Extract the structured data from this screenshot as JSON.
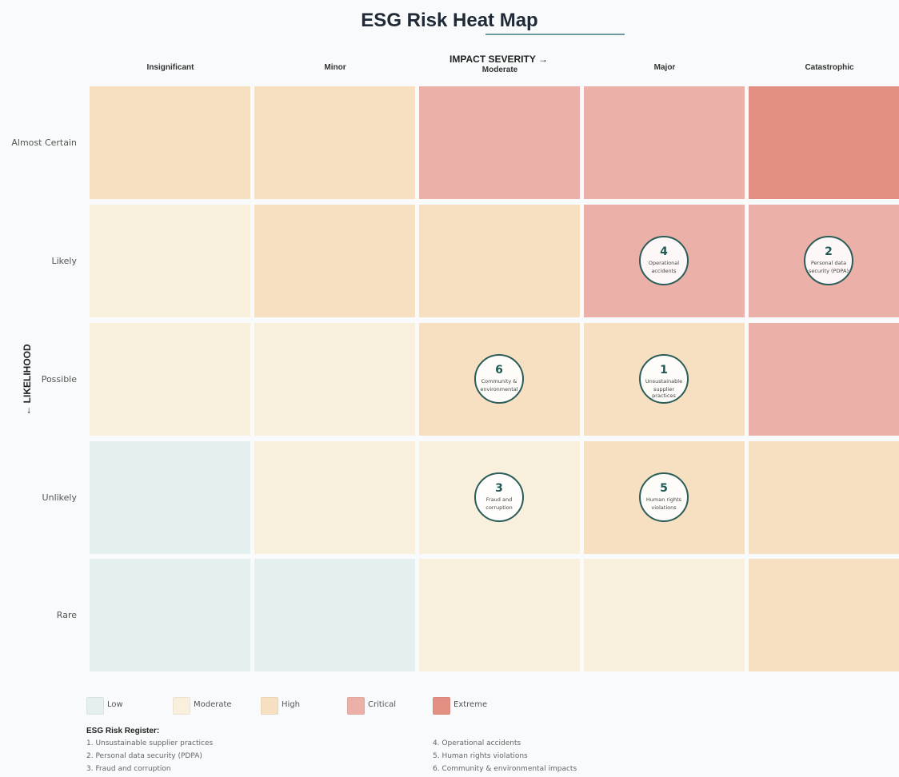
{
  "title": "ESG Risk Heat Map",
  "chart_data": {
    "type": "heatmap",
    "title": "ESG Risk Heat Map",
    "xlabel": "IMPACT SEVERITY →",
    "ylabel": "← LIKELIHOOD",
    "columns": [
      "Insignificant",
      "Minor",
      "Moderate",
      "Major",
      "Catastrophic"
    ],
    "rows": [
      "Almost Certain",
      "Likely",
      "Possible",
      "Unlikely",
      "Rare"
    ],
    "levels": [
      [
        "High",
        "High",
        "Critical",
        "Critical",
        "Extreme"
      ],
      [
        "Moderate",
        "High",
        "High",
        "Critical",
        "Critical"
      ],
      [
        "Moderate",
        "Moderate",
        "High",
        "High",
        "Critical"
      ],
      [
        "Low",
        "Moderate",
        "Moderate",
        "High",
        "High"
      ],
      [
        "Low",
        "Low",
        "Moderate",
        "Moderate",
        "High"
      ]
    ],
    "risks": [
      {
        "id": "1",
        "label": "Unsustainable supplier practices",
        "likelihood": "Possible",
        "impact": "Major"
      },
      {
        "id": "2",
        "label": "Personal data security (PDPA)",
        "likelihood": "Likely",
        "impact": "Catastrophic"
      },
      {
        "id": "3",
        "label": "Fraud and corruption",
        "likelihood": "Unlikely",
        "impact": "Moderate"
      },
      {
        "id": "4",
        "label": "Operational accidents",
        "likelihood": "Likely",
        "impact": "Major"
      },
      {
        "id": "5",
        "label": "Human rights violations",
        "likelihood": "Unlikely",
        "impact": "Major"
      },
      {
        "id": "6",
        "label": "Community & environmental impacts",
        "likelihood": "Possible",
        "impact": "Moderate"
      }
    ],
    "legend": [
      {
        "label": "Low",
        "color": "#e3f0ef"
      },
      {
        "label": "Moderate",
        "color": "#f8efdd"
      },
      {
        "label": "High",
        "color": "#f6e0c1"
      },
      {
        "label": "Critical",
        "color": "#ebb0a8"
      },
      {
        "label": "Extreme",
        "color": "#e48f84"
      }
    ]
  },
  "register": {
    "title": "ESG Risk Register:",
    "items": [
      "1. Unsustainable supplier practices",
      "2. Personal data security (PDPA)",
      "3. Fraud and corruption",
      "4. Operational accidents",
      "5. Human rights violations",
      "6. Community & environmental impacts"
    ]
  }
}
